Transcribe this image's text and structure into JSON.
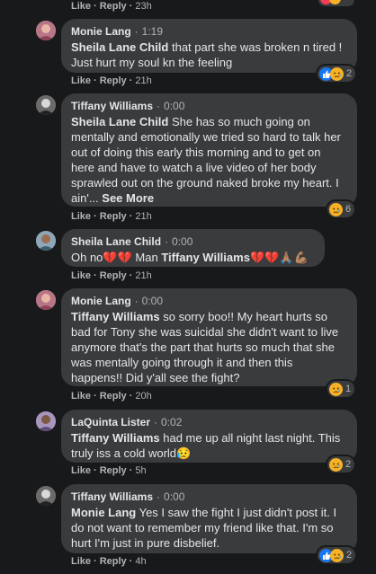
{
  "top_meta": {
    "like": "Like",
    "reply": "Reply",
    "time": "23h"
  },
  "comments": [
    {
      "author": "Monie Lang",
      "video_time": "1:19",
      "mention": "Sheila Lane Child",
      "text": " that part she was broken n tired ! Just hurt my soul kn the feeling",
      "reactions": [
        "like",
        "sad"
      ],
      "reaction_count": "2",
      "like": "Like",
      "reply": "Reply",
      "time": "21h"
    },
    {
      "author": "Tiffany Williams",
      "video_time": "0:00",
      "mention": "Sheila Lane Child",
      "text": " She has so much going on mentally and emotionally we tried so hard to talk her out of doing this early this morning and to get on here and have to watch a live video of her body sprawled out on the ground naked broke my heart. I ain'... ",
      "see_more": "See More",
      "reactions": [
        "sad"
      ],
      "reaction_count": "6",
      "like": "Like",
      "reply": "Reply",
      "time": "21h"
    },
    {
      "author": "Sheila Lane Child",
      "video_time": "0:00",
      "text_pre": "Oh no💔💔 Man ",
      "mention": "Tiffany Williams",
      "text_post": "💔💔🙏🏽💪🏽",
      "like": "Like",
      "reply": "Reply",
      "time": "21h"
    },
    {
      "author": "Monie Lang",
      "video_time": "0:00",
      "mention": "Tiffany Williams",
      "text": " so sorry boo!! My heart hurts so bad for Tony she was suicidal she didn't want to live anymore that's the part that hurts so much that she was mentally going through it and then this happens!! Did y'all see the fight?",
      "reactions": [
        "sad"
      ],
      "reaction_count": "1",
      "like": "Like",
      "reply": "Reply",
      "time": "20h"
    },
    {
      "author": "LaQuinta Lister",
      "video_time": "0:02",
      "mention": "Tiffany Williams",
      "text": " had me up all night last night. This truly iss a cold world😥",
      "reactions": [
        "sad"
      ],
      "reaction_count": "2",
      "like": "Like",
      "reply": "Reply",
      "time": "5h"
    },
    {
      "author": "Tiffany Williams",
      "video_time": "0:00",
      "mention": "Monie Lang",
      "text": " Yes I saw the fight I just didn't post it. I do not want to remember my friend like that. I'm so hurt I'm just in pure disbelief.",
      "reactions": [
        "like",
        "sad"
      ],
      "reaction_count": "2",
      "like": "Like",
      "reply": "Reply",
      "time": "4h"
    }
  ],
  "colors": {
    "background": "#18191a",
    "bubble": "#3a3b3c",
    "like_blue": "#1877f2",
    "sad_yellow": "#f7b125",
    "meta_gray": "#b0b3b8"
  }
}
